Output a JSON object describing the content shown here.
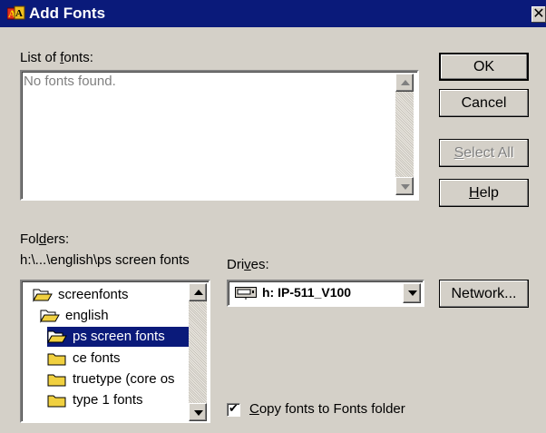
{
  "window": {
    "title": "Add Fonts",
    "close_glyph": "✕",
    "app_icon": "fonts-app-icon"
  },
  "font_list": {
    "label_prefix": "List of ",
    "label_accel": "f",
    "label_suffix": "onts:",
    "items": [
      "No fonts found."
    ]
  },
  "buttons": {
    "ok": "OK",
    "cancel": "Cancel",
    "select_all_accel": "S",
    "select_all_rest": "elect All",
    "select_all_enabled": false,
    "help_accel": "H",
    "help_rest": "elp",
    "network": "Network..."
  },
  "folders": {
    "label_prefix": "Fol",
    "label_accel": "d",
    "label_suffix": "ers:",
    "current_path": "h:\\...\\english\\ps screen fonts",
    "items": [
      {
        "label": "screenfonts",
        "icon": "open-folder-icon"
      },
      {
        "label": "english",
        "icon": "open-folder-icon"
      },
      {
        "label": "ps screen fonts",
        "icon": "open-folder-icon",
        "selected": true
      },
      {
        "label": "ce fonts",
        "icon": "folder-icon"
      },
      {
        "label": "truetype (core os",
        "icon": "folder-icon"
      },
      {
        "label": "type 1 fonts",
        "icon": "folder-icon"
      }
    ]
  },
  "drives": {
    "label_prefix": "Dri",
    "label_accel": "v",
    "label_suffix": "es:",
    "selected": "h: IP-511_V100",
    "icon": "network-drive-icon"
  },
  "copy_option": {
    "accel": "C",
    "rest": "opy fonts to Fonts folder",
    "checked": true,
    "check_glyph": "✔"
  },
  "colors": {
    "title_bar": "#0a1a7a",
    "dialog_face": "#d4d0c8",
    "selection": "#0a1a7a",
    "folder_yellow": "#f0d040"
  }
}
